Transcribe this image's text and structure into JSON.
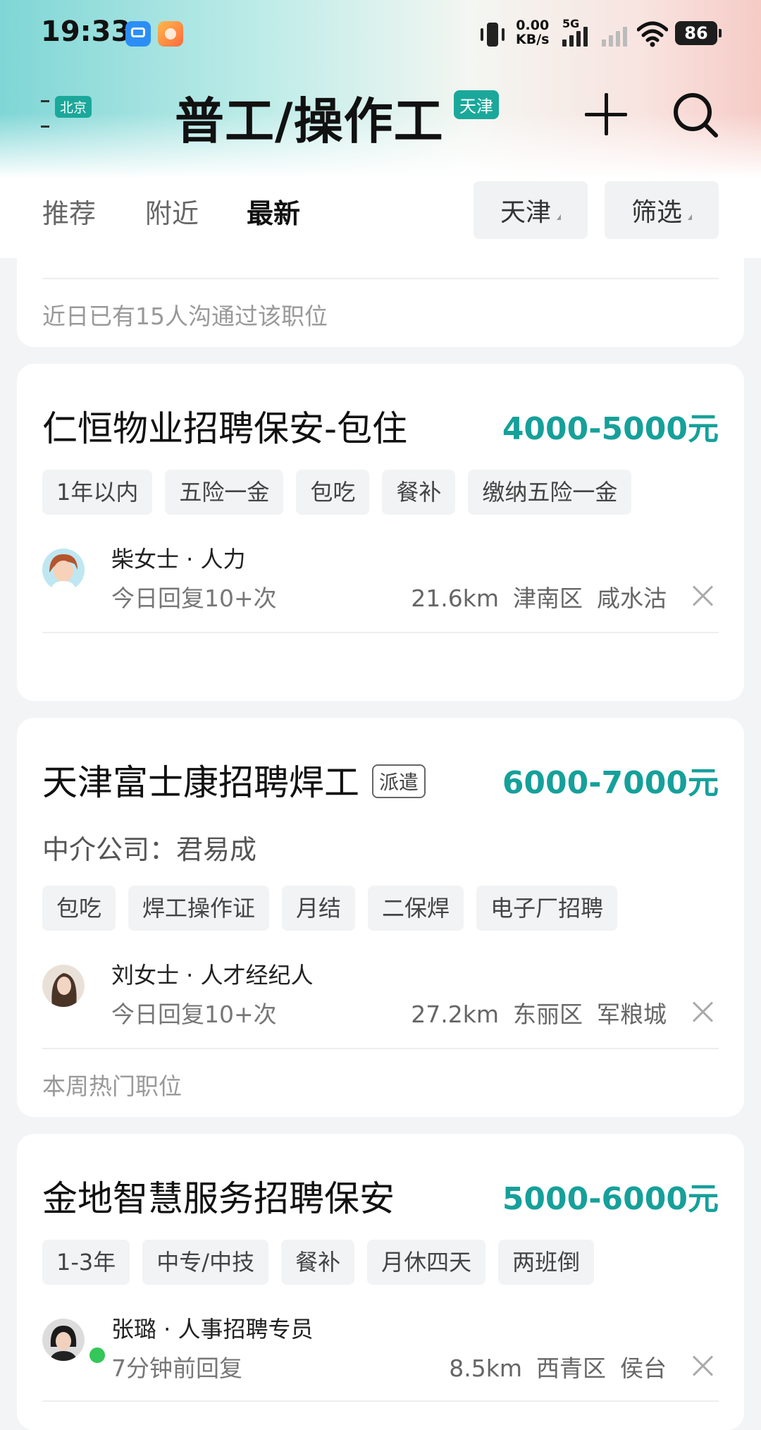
{
  "status_bar": {
    "time": "19:33",
    "net_speed_value": "0.00",
    "net_speed_unit": "KB/s",
    "signal_label": "5G",
    "battery": "86"
  },
  "header": {
    "location_badge": "北京",
    "title": "普工/操作工",
    "city_badge": "天津",
    "plus_icon": "plus-icon",
    "search_icon": "search-icon"
  },
  "tabs": {
    "items": [
      "推荐",
      "附近",
      "最新"
    ],
    "active": "最新",
    "city_filter": "天津",
    "filter": "筛选"
  },
  "partial_card": {
    "note": "近日已有15人沟通过该职位"
  },
  "jobs": [
    {
      "title": "仁恒物业招聘保安-包住",
      "salary": "4000-5000元",
      "tags": [
        "1年以内",
        "五险一金",
        "包吃",
        "餐补",
        "缴纳五险一金"
      ],
      "recruiter": "柴女士 · 人力",
      "reply": "今日回复10+次",
      "distance": "21.6km",
      "district": "津南区",
      "area": "咸水沽"
    },
    {
      "title": "天津富士康招聘焊工",
      "badge": "派遣",
      "company": "中介公司：君易成",
      "salary": "6000-7000元",
      "tags": [
        "包吃",
        "焊工操作证",
        "月结",
        "二保焊",
        "电子厂招聘"
      ],
      "recruiter": "刘女士 · 人才经纪人",
      "reply": "今日回复10+次",
      "distance": "27.2km",
      "district": "东丽区",
      "area": "军粮城",
      "note": "本周热门职位"
    },
    {
      "title": "金地智慧服务招聘保安",
      "salary": "5000-6000元",
      "tags": [
        "1-3年",
        "中专/中技",
        "餐补",
        "月休四天",
        "两班倒"
      ],
      "recruiter": "张璐 · 人事招聘专员",
      "reply": "7分钟前回复",
      "distance": "8.5km",
      "district": "西青区",
      "area": "侯台"
    }
  ],
  "colors": {
    "accent": "#16a09a",
    "badge": "#1aa89a",
    "online": "#34c759"
  }
}
